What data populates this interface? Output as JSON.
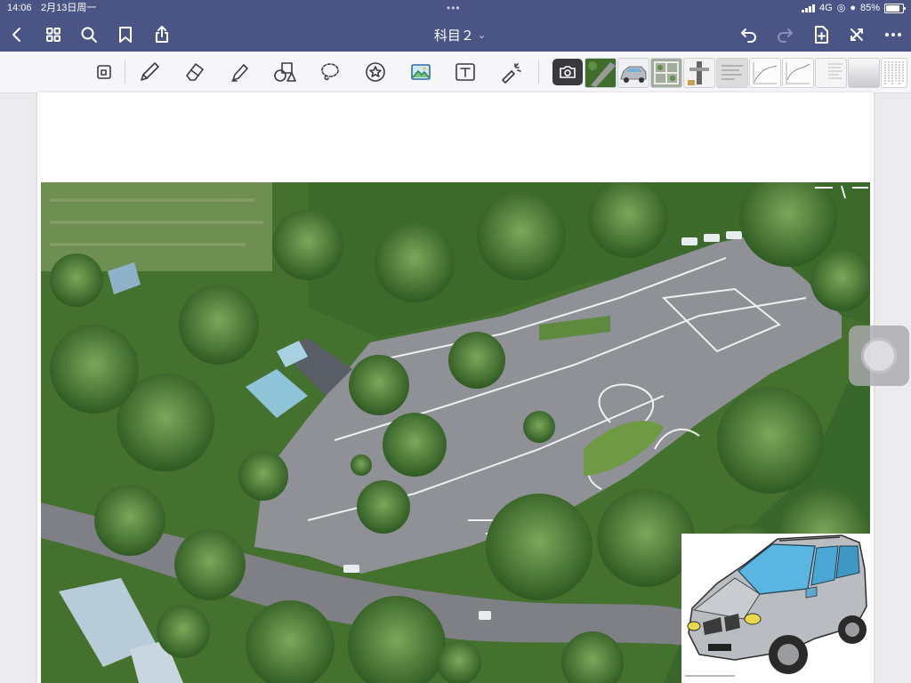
{
  "status_bar": {
    "time": "14:06",
    "date": "2月13日周一",
    "network": "4G",
    "battery": "85%"
  },
  "nav": {
    "title": "科目２",
    "icons": [
      "back-icon",
      "thumbnails-grid-icon",
      "search-icon",
      "bookmark-icon",
      "share-icon",
      "undo-icon",
      "redo-icon",
      "add-page-icon",
      "close-fullscreen-icon",
      "more-icon"
    ]
  },
  "toolbar": {
    "tools": [
      "lasso-select-icon",
      "pen-icon",
      "eraser-icon",
      "highlighter-icon",
      "shapes-icon",
      "lasso-icon",
      "sticker-icon",
      "image-icon",
      "text-icon",
      "laser-pointer-icon",
      "camera-icon"
    ],
    "recent_images": [
      "aerial-thumbnail",
      "car-thumbnail",
      "map-thumbnail",
      "equipment-thumbnail",
      "doc-thumbnail-1",
      "chart-thumbnail-1",
      "chart-thumbnail-2",
      "doc-thumbnail-2",
      "doc-thumbnail-3",
      "doc-thumbnail-4",
      "text-doc-thumbnail"
    ]
  },
  "colors": {
    "header": "#4a5585",
    "toolbar": "#f6f6f8",
    "canvas": "#ececef",
    "vegetation": "#3f6a2b",
    "road": "#8d8f93"
  }
}
